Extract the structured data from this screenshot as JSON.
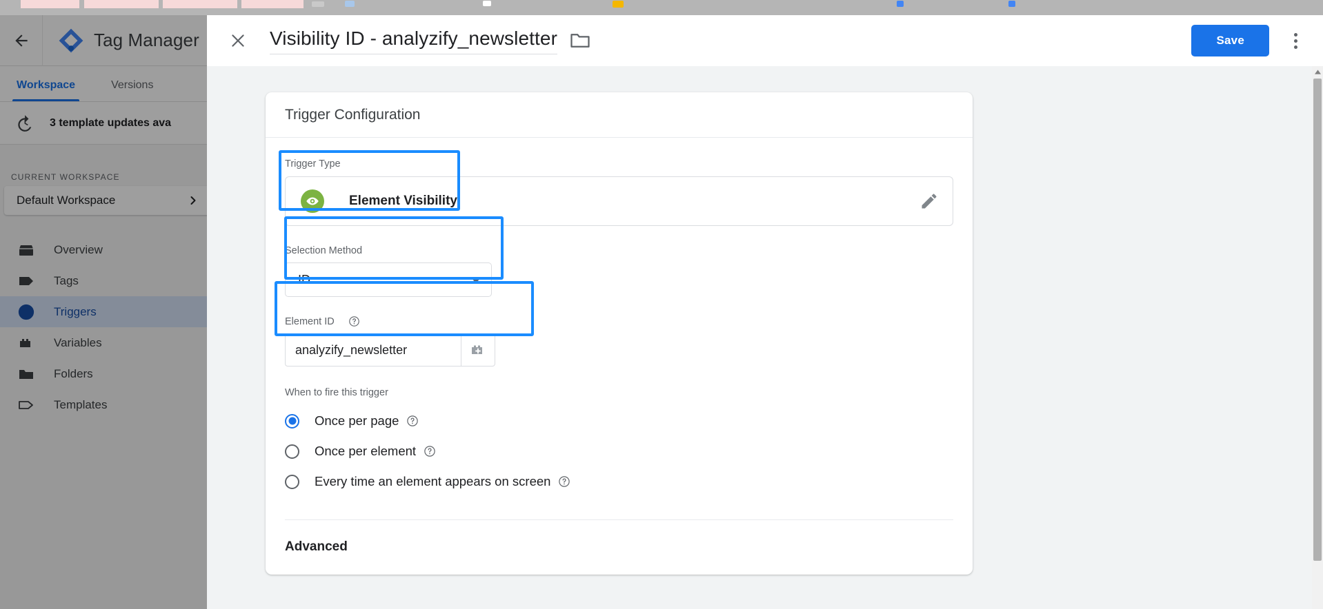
{
  "browser": {
    "tabs": [
      "",
      "",
      "",
      ""
    ],
    "strip_color": "#b5b5b5",
    "tab_color": "#f6d9d9"
  },
  "app": {
    "product_title": "Tag Manager",
    "back_icon": "arrow-left-icon",
    "logo_icon": "tag-manager-logo-icon",
    "tabs": [
      {
        "label": "Workspace",
        "active": true
      },
      {
        "label": "Versions",
        "active": false
      }
    ],
    "notice": {
      "icon": "history-update-icon",
      "text": "3 template updates ava"
    },
    "workspace": {
      "section_label": "CURRENT WORKSPACE",
      "name": "Default Workspace",
      "chevron_icon": "chevron-right-icon"
    },
    "nav": [
      {
        "label": "Overview",
        "icon": "overview-icon",
        "selected": false
      },
      {
        "label": "Tags",
        "icon": "tag-icon",
        "selected": false
      },
      {
        "label": "Triggers",
        "icon": "trigger-icon",
        "selected": true
      },
      {
        "label": "Variables",
        "icon": "variables-icon",
        "selected": false
      },
      {
        "label": "Folders",
        "icon": "folder-icon",
        "selected": false
      },
      {
        "label": "Templates",
        "icon": "template-icon",
        "selected": false
      }
    ]
  },
  "modal": {
    "close_icon": "close-icon",
    "title": "Visibility ID - analyzify_newsletter",
    "folder_icon": "folder-move-icon",
    "save_label": "Save",
    "more_icon": "more-vertical-icon",
    "accent_color": "#1a73e8"
  },
  "card": {
    "heading": "Trigger Configuration",
    "trigger_type": {
      "label": "Trigger Type",
      "name": "Element Visibility",
      "icon": "eye-visibility-icon",
      "icon_color": "#7cb342",
      "edit_icon": "pencil-edit-icon"
    },
    "selection_method": {
      "label": "Selection Method",
      "value": "ID",
      "dropdown_icon": "chevron-down-icon"
    },
    "element_id": {
      "label": "Element ID",
      "help_icon": "help-circle-icon",
      "value": "analyzify_newsletter",
      "variable_picker_icon": "add-variable-icon"
    },
    "when_to_fire": {
      "label": "When to fire this trigger",
      "options": [
        {
          "label": "Once per page",
          "selected": true,
          "help_icon": "help-circle-icon"
        },
        {
          "label": "Once per element",
          "selected": false,
          "help_icon": "help-circle-icon"
        },
        {
          "label": "Every time an element appears on screen",
          "selected": false,
          "help_icon": "help-circle-icon"
        }
      ]
    },
    "advanced_heading": "Advanced"
  },
  "highlights": {
    "color": "#1a8cff",
    "boxes": [
      "trigger-type-box",
      "selection-method-box",
      "element-id-box"
    ]
  },
  "scrollbar": {
    "up_arrow_icon": "scroll-up-arrow-icon"
  }
}
